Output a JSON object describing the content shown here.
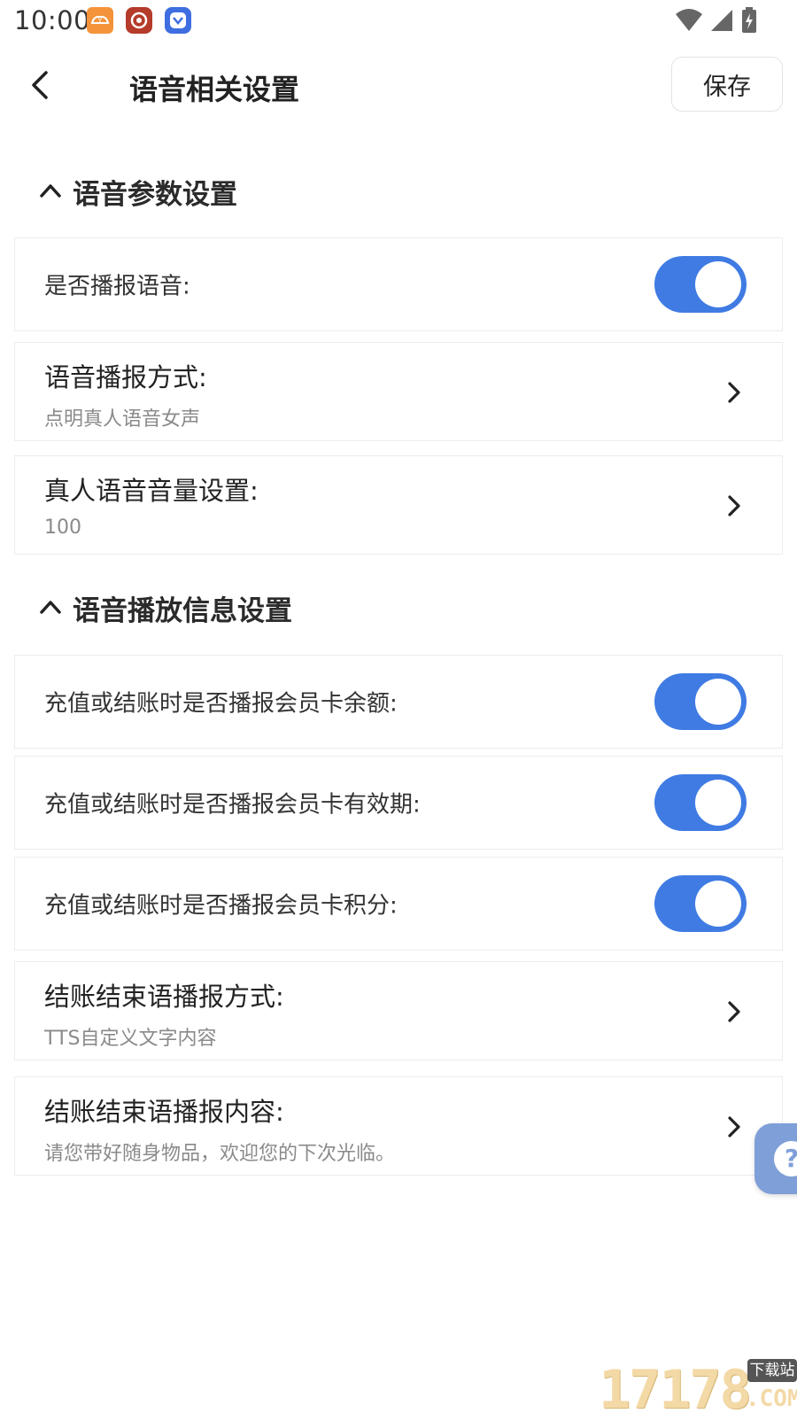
{
  "status_bar": {
    "time": "10:00"
  },
  "header": {
    "title": "语音相关设置",
    "save_label": "保存"
  },
  "sections": [
    {
      "title": "语音参数设置",
      "items": [
        {
          "type": "toggle",
          "label": "是否播报语音:",
          "on": true
        },
        {
          "type": "nav",
          "label": "语音播报方式:",
          "value": "点明真人语音女声"
        },
        {
          "type": "nav",
          "label": "真人语音音量设置:",
          "value": "100"
        }
      ]
    },
    {
      "title": "语音播放信息设置",
      "items": [
        {
          "type": "toggle",
          "label": "充值或结账时是否播报会员卡余额:",
          "on": true
        },
        {
          "type": "toggle",
          "label": "充值或结账时是否播报会员卡有效期:",
          "on": true
        },
        {
          "type": "toggle",
          "label": "充值或结账时是否播报会员卡积分:",
          "on": true
        },
        {
          "type": "nav",
          "label": "结账结束语播报方式:",
          "value": "TTS自定义文字内容"
        },
        {
          "type": "nav",
          "label": "结账结束语播报内容:",
          "value": "请您带好随身物品，欢迎您的下次光临。"
        }
      ]
    }
  ],
  "help_button": {
    "glyph": "?"
  },
  "watermark": {
    "digits": "17178",
    "badge": "下载站",
    "suffix": ".COM"
  },
  "colors": {
    "toggle_on": "#3f7be3",
    "help_button": "#7f9fd8"
  }
}
